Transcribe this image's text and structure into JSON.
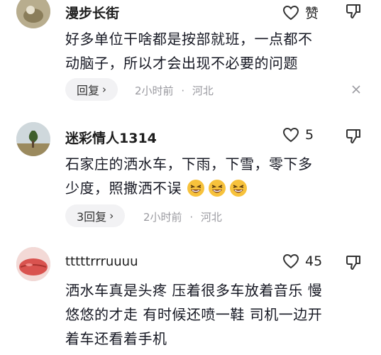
{
  "comments": [
    {
      "username": "漫步长街",
      "like_label": "赞",
      "lines": [
        "好多单位干啥都是按部就班，一点都不",
        "动脑子，所以才会出现不必要的问题"
      ],
      "reply_label": "回复",
      "time": "2小时前",
      "location": "河北"
    },
    {
      "username": "迷彩情人1314",
      "like_count": "5",
      "lines": [
        "石家庄的洒水车，下雨，下雪，零下多",
        "少度，照撒洒不误"
      ],
      "emoji": "grinning-squinting-face",
      "emoji_count": 3,
      "reply_label": "3回复",
      "time": "2小时前",
      "location": "河北"
    },
    {
      "username": "tttttrrruuuu",
      "like_count": "45",
      "lines": [
        "洒水车真是头疼 压着很多车放着音乐 慢",
        "悠悠的才走 有时候还喷一鞋 司机一边开",
        "着车还看着手机"
      ]
    }
  ],
  "separator": "·",
  "chevron": "›",
  "colors": {
    "text": "#161823",
    "meta": "#9a9aa0",
    "pill": "#f2f2f4",
    "emoji": "#f7c23c"
  }
}
